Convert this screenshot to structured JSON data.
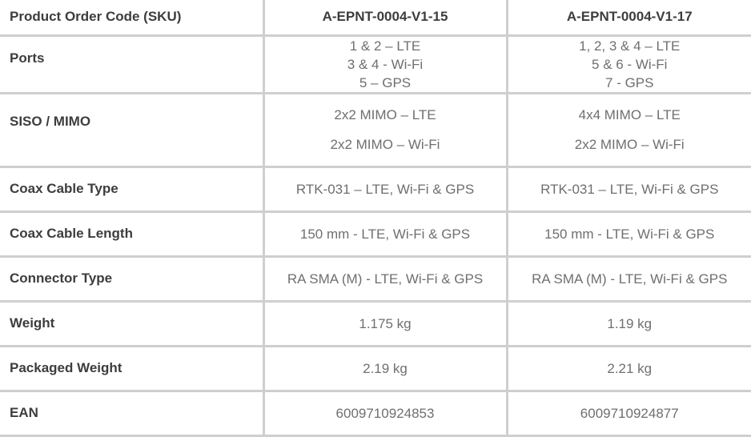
{
  "table": {
    "header": {
      "label": "Product Order Code (SKU)",
      "col1": "A-EPNT-0004-V1-15",
      "col2": "A-EPNT-0004-V1-17"
    },
    "rows": [
      {
        "label": "Ports",
        "col1": [
          "1 & 2 – LTE",
          "3 & 4 - Wi-Fi",
          "5 – GPS"
        ],
        "col2": [
          "1, 2, 3 & 4 – LTE",
          "5 & 6 - Wi-Fi",
          "7 - GPS"
        ]
      },
      {
        "label": "SISO / MIMO",
        "col1": [
          "2x2 MIMO – LTE",
          "2x2 MIMO – Wi-Fi"
        ],
        "col2": [
          "4x4 MIMO – LTE",
          "2x2 MIMO – Wi-Fi"
        ]
      },
      {
        "label": "Coax Cable Type",
        "col1": "RTK-031  – LTE, Wi-Fi & GPS",
        "col2": "RTK-031  – LTE, Wi-Fi & GPS"
      },
      {
        "label": "Coax Cable Length",
        "col1": "150 mm - LTE, Wi-Fi & GPS",
        "col2": "150 mm - LTE, Wi-Fi & GPS"
      },
      {
        "label": "Connector Type",
        "col1": "RA SMA (M) - LTE, Wi-Fi & GPS",
        "col2": "RA SMA (M) - LTE, Wi-Fi & GPS"
      },
      {
        "label": "Weight",
        "col1": "1.175 kg",
        "col2": "1.19 kg"
      },
      {
        "label": "Packaged Weight",
        "col1": "2.19 kg",
        "col2": "2.21 kg"
      },
      {
        "label": "EAN",
        "col1": "6009710924853",
        "col2": "6009710924877"
      }
    ]
  }
}
